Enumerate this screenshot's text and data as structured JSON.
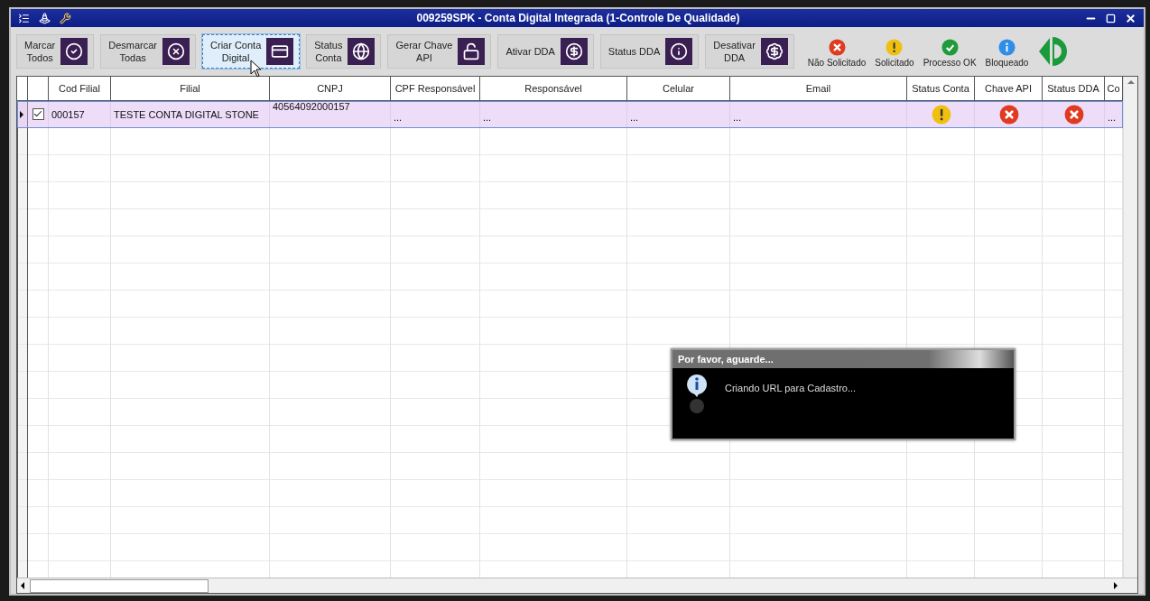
{
  "window": {
    "title": "009259SPK - Conta Digital Integrada (1-Controle De Qualidade)"
  },
  "toolbar": [
    {
      "label": "Marcar\nTodos",
      "focused": false
    },
    {
      "label": "Desmarcar\nTodas",
      "focused": false
    },
    {
      "label": "Criar Conta\nDigital",
      "focused": true
    },
    {
      "label": "Status\nConta",
      "focused": false
    },
    {
      "label": "Gerar Chave\nAPI",
      "focused": false
    },
    {
      "label": "Ativar DDA",
      "focused": false
    },
    {
      "label": "Status DDA",
      "focused": false
    },
    {
      "label": "Desativar\nDDA",
      "focused": false
    }
  ],
  "legend": [
    {
      "kind": "error",
      "label": "Não Solicitado"
    },
    {
      "kind": "warning",
      "label": "Solicitado"
    },
    {
      "kind": "ok",
      "label": "Processo OK"
    },
    {
      "kind": "info",
      "label": "Bloqueado"
    }
  ],
  "table": {
    "columns": [
      "Cod Filial",
      "Filial",
      "CNPJ",
      "CPF Responsável",
      "Responsável",
      "Celular",
      "Email",
      "Status Conta",
      "Chave API",
      "Status DDA",
      "Co"
    ],
    "rows": [
      {
        "selected": true,
        "checked": true,
        "cod_filial": "000157",
        "filial": "TESTE CONTA DIGITAL STONE",
        "cnpj": "40564092000157",
        "cpf_responsavel": "...",
        "responsavel": "...",
        "celular": "...",
        "email": "...",
        "status_conta": {
          "kind": "warning"
        },
        "chave_api": {
          "kind": "error"
        },
        "status_dda": {
          "kind": "error"
        },
        "column_11": "..."
      }
    ]
  },
  "dialog": {
    "title": "Por favor, aguarde...",
    "message": "Criando URL para Cadastro..."
  }
}
